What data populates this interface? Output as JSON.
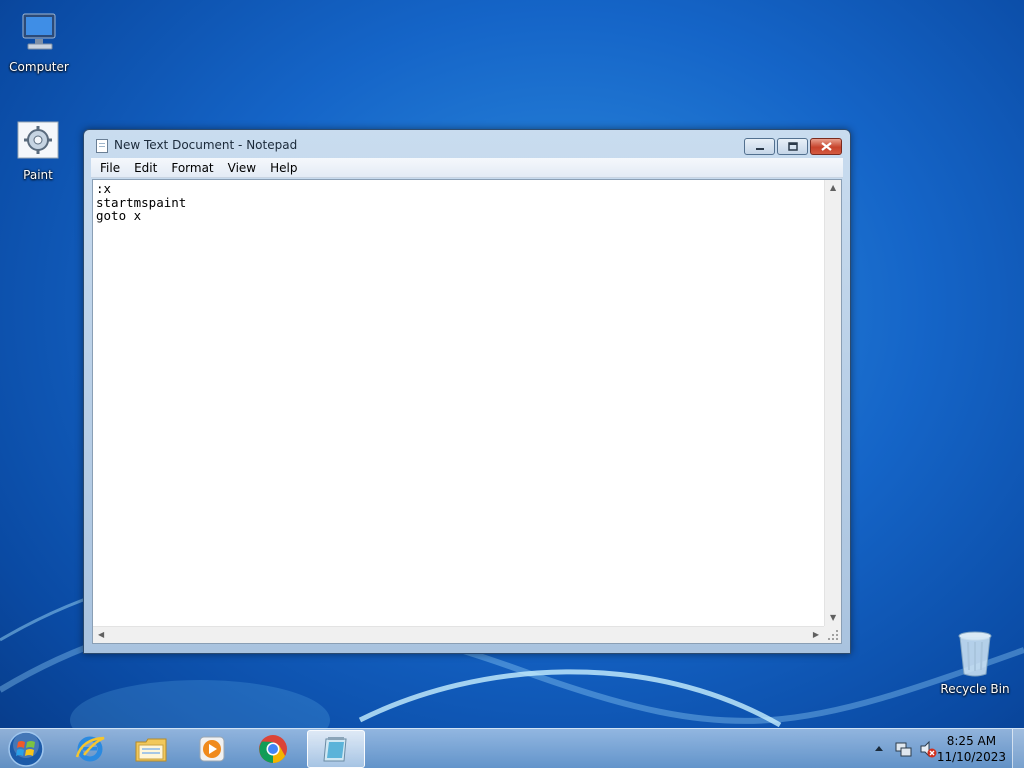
{
  "desktop": {
    "icons": [
      {
        "label": "Computer"
      },
      {
        "label": "Paint"
      },
      {
        "label": "Recycle Bin"
      }
    ]
  },
  "notepad": {
    "title": "New Text Document - Notepad",
    "menu": [
      "File",
      "Edit",
      "Format",
      "View",
      "Help"
    ],
    "content": ":x\nstartmspaint\ngoto x"
  },
  "taskbar": {
    "pinned": [
      "internet-explorer-icon",
      "windows-explorer-icon",
      "media-player-icon",
      "chrome-icon",
      "notepad-icon"
    ],
    "active": "notepad-icon",
    "clock": {
      "time": "8:25 AM",
      "date": "11/10/2023"
    }
  }
}
